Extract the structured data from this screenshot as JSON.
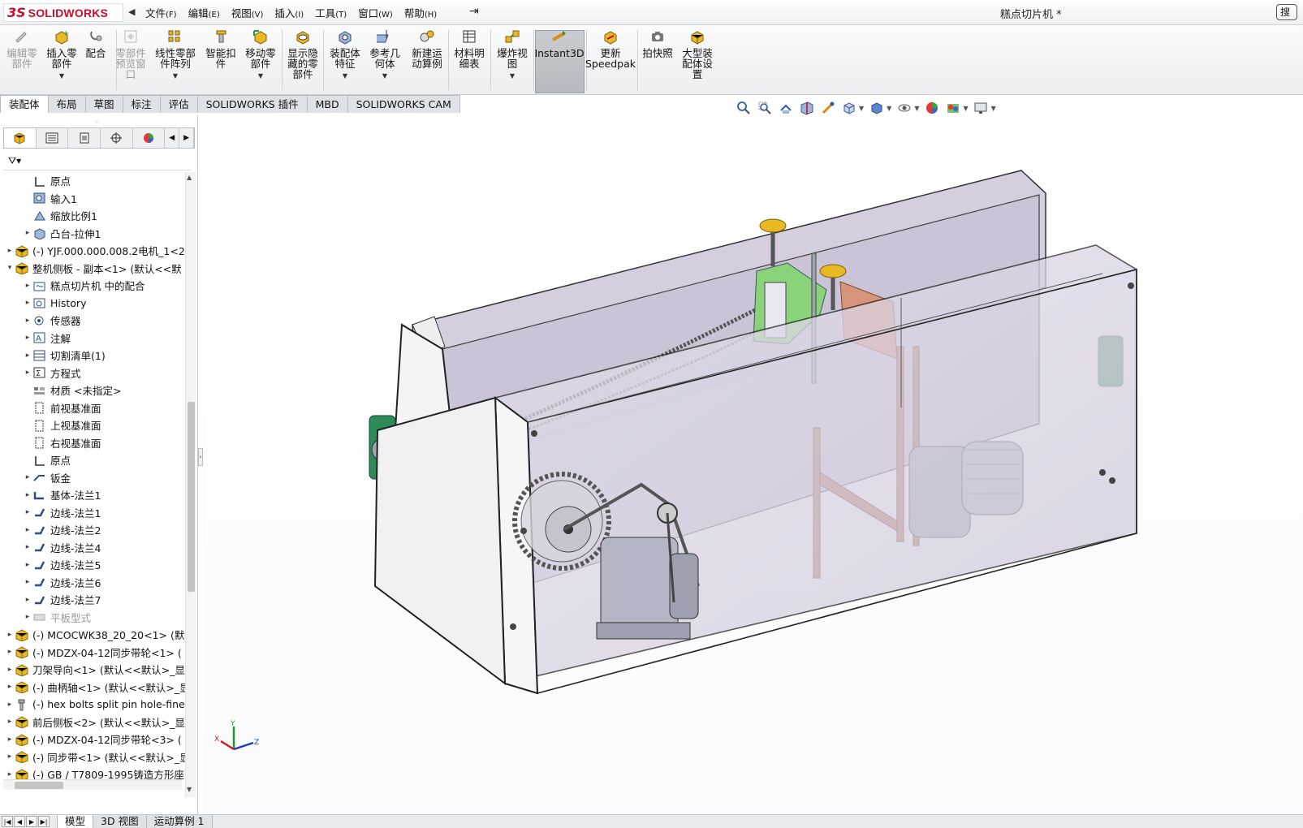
{
  "app": {
    "logo_ds": "3S",
    "logo_word": "SOLIDWORKS",
    "doc_title": "糕点切片机 *",
    "help_label": "搜"
  },
  "menu": [
    {
      "label": "文件",
      "acc": "(F)"
    },
    {
      "label": "编辑",
      "acc": "(E)"
    },
    {
      "label": "视图",
      "acc": "(V)"
    },
    {
      "label": "插入",
      "acc": "(I)"
    },
    {
      "label": "工具",
      "acc": "(T)"
    },
    {
      "label": "窗口",
      "acc": "(W)"
    },
    {
      "label": "帮助",
      "acc": "(H)"
    }
  ],
  "commands": [
    {
      "label": "编辑零\n部件",
      "icon": "edit-component-icon",
      "enabled": false
    },
    {
      "label": "插入零\n部件",
      "icon": "insert-component-icon",
      "enabled": true
    },
    {
      "label": "配合",
      "icon": "mate-icon",
      "enabled": true
    },
    {
      "label": "零部件\n预览窗\n口",
      "icon": "component-preview-icon",
      "enabled": false
    },
    {
      "label": "线性零部\n件阵列",
      "icon": "linear-pattern-icon",
      "enabled": true
    },
    {
      "label": "智能扣\n件",
      "icon": "smart-fastener-icon",
      "enabled": true
    },
    {
      "label": "移动零\n部件",
      "icon": "move-component-icon",
      "enabled": true
    },
    {
      "label": "显示隐\n藏的零\n部件",
      "icon": "show-hidden-icon",
      "enabled": true
    },
    {
      "label": "装配体\n特征",
      "icon": "assembly-feature-icon",
      "enabled": true
    },
    {
      "label": "参考几\n何体",
      "icon": "reference-geometry-icon",
      "enabled": true
    },
    {
      "label": "新建运\n动算例",
      "icon": "motion-study-icon",
      "enabled": true
    },
    {
      "label": "材料明\n细表",
      "icon": "bom-icon",
      "enabled": true
    },
    {
      "label": "爆炸视\n图",
      "icon": "exploded-view-icon",
      "enabled": true
    },
    {
      "label": "Instant3D",
      "icon": "instant3d-icon",
      "enabled": true
    },
    {
      "label": "更新\nSpeedpak",
      "icon": "speedpak-icon",
      "enabled": true
    },
    {
      "label": "拍快照",
      "icon": "snapshot-icon",
      "enabled": true
    },
    {
      "label": "大型装\n配体设\n置",
      "icon": "large-assembly-icon",
      "enabled": true
    }
  ],
  "cm_tabs": [
    "装配体",
    "布局",
    "草图",
    "标注",
    "评估",
    "SOLIDWORKS 插件",
    "MBD",
    "SOLIDWORKS CAM"
  ],
  "tree": [
    {
      "label": "原点",
      "icon": "origin-icon",
      "indent": 2,
      "expander": ""
    },
    {
      "label": "输入1",
      "icon": "import-icon",
      "indent": 2,
      "expander": ""
    },
    {
      "label": "缩放比例1",
      "icon": "scale-icon",
      "indent": 2,
      "expander": ""
    },
    {
      "label": "凸台-拉伸1",
      "icon": "extrude-icon",
      "indent": 2,
      "expander": "▸"
    },
    {
      "label": "(-) YJF.000.000.008.2电机_1<2>",
      "icon": "part-icon",
      "indent": 0,
      "expander": "▸"
    },
    {
      "label": "整机侧板 - 副本<1> (默认<<默",
      "icon": "part-icon",
      "indent": 0,
      "expander": "▾"
    },
    {
      "label": "糕点切片机 中的配合",
      "icon": "mates-folder-icon",
      "indent": 2,
      "expander": "▸"
    },
    {
      "label": "History",
      "icon": "history-icon",
      "indent": 2,
      "expander": "▸"
    },
    {
      "label": "传感器",
      "icon": "sensor-icon",
      "indent": 2,
      "expander": "▸"
    },
    {
      "label": "注解",
      "icon": "annotation-icon",
      "indent": 2,
      "expander": "▸"
    },
    {
      "label": "切割清单(1)",
      "icon": "cutlist-icon",
      "indent": 2,
      "expander": "▸"
    },
    {
      "label": "方程式",
      "icon": "equation-icon",
      "indent": 2,
      "expander": "▸"
    },
    {
      "label": "材质 <未指定>",
      "icon": "material-icon",
      "indent": 2,
      "expander": ""
    },
    {
      "label": "前视基准面",
      "icon": "plane-icon",
      "indent": 2,
      "expander": ""
    },
    {
      "label": "上视基准面",
      "icon": "plane-icon",
      "indent": 2,
      "expander": ""
    },
    {
      "label": "右视基准面",
      "icon": "plane-icon",
      "indent": 2,
      "expander": ""
    },
    {
      "label": "原点",
      "icon": "origin-icon",
      "indent": 2,
      "expander": ""
    },
    {
      "label": "钣金",
      "icon": "sheetmetal-icon",
      "indent": 2,
      "expander": "▸"
    },
    {
      "label": "基体-法兰1",
      "icon": "base-flange-icon",
      "indent": 2,
      "expander": "▸"
    },
    {
      "label": "边线-法兰1",
      "icon": "edge-flange-icon",
      "indent": 2,
      "expander": "▸"
    },
    {
      "label": "边线-法兰2",
      "icon": "edge-flange-icon",
      "indent": 2,
      "expander": "▸"
    },
    {
      "label": "边线-法兰4",
      "icon": "edge-flange-icon",
      "indent": 2,
      "expander": "▸"
    },
    {
      "label": "边线-法兰5",
      "icon": "edge-flange-icon",
      "indent": 2,
      "expander": "▸"
    },
    {
      "label": "边线-法兰6",
      "icon": "edge-flange-icon",
      "indent": 2,
      "expander": "▸"
    },
    {
      "label": "边线-法兰7",
      "icon": "edge-flange-icon",
      "indent": 2,
      "expander": "▸"
    },
    {
      "label": "平板型式",
      "icon": "flat-pattern-icon",
      "indent": 2,
      "expander": "▸",
      "dim": true
    },
    {
      "label": "(-) MCOCWK38_20_20<1> (默",
      "icon": "part-icon",
      "indent": 0,
      "expander": "▸"
    },
    {
      "label": "(-) MDZX-04-12同步带轮<1> (",
      "icon": "part-icon",
      "indent": 0,
      "expander": "▸"
    },
    {
      "label": "刀架导向<1> (默认<<默认>_显",
      "icon": "part-icon",
      "indent": 0,
      "expander": "▸"
    },
    {
      "label": "(-) 曲柄轴<1> (默认<<默认>_显",
      "icon": "part-icon",
      "indent": 0,
      "expander": "▸"
    },
    {
      "label": "(-) hex bolts split pin hole-fine",
      "icon": "bolt-icon",
      "indent": 0,
      "expander": "▸"
    },
    {
      "label": "前后侧板<2> (默认<<默认>_显",
      "icon": "part-icon",
      "indent": 0,
      "expander": "▸"
    },
    {
      "label": "(-) MDZX-04-12同步带轮<3> (",
      "icon": "part-icon",
      "indent": 0,
      "expander": "▸"
    },
    {
      "label": "(-) 同步带<1> (默认<<默认>_显",
      "icon": "part-icon",
      "indent": 0,
      "expander": "▸"
    },
    {
      "label": "(-) GB / T7809-1995铸造方形座",
      "icon": "part-icon",
      "indent": 0,
      "expander": "▸"
    }
  ],
  "bottom_tabs": [
    "模型",
    "3D 视图",
    "运动算例 1"
  ],
  "triad": {
    "x": "X",
    "y": "Y",
    "z": "Z"
  },
  "colors": {
    "accent_red": "#c8102e",
    "part_yellow": "#e8b923",
    "housing_tint": "#d9d3e4",
    "bearing_green": "#2e8b57"
  }
}
